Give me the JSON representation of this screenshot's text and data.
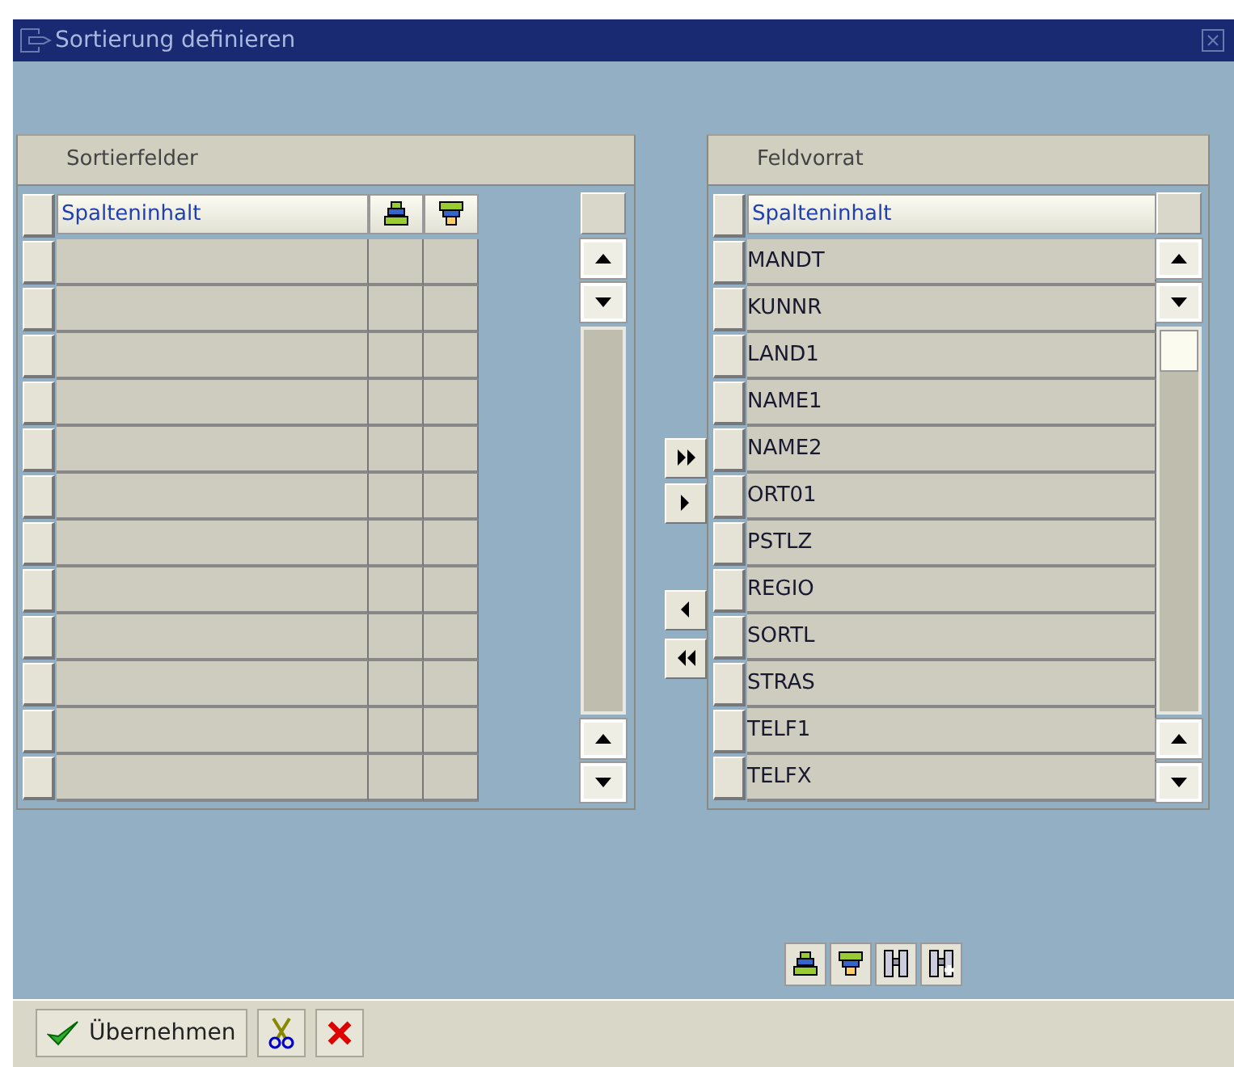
{
  "window": {
    "title": "Sortierung definieren"
  },
  "sort_fields": {
    "title": "Sortierfelder",
    "column": "Spalteninhalt"
  },
  "field_pool": {
    "title": "Feldvorrat",
    "column": "Spalteninhalt",
    "rows": [
      "MANDT",
      "KUNNR",
      "LAND1",
      "NAME1",
      "NAME2",
      "ORT01",
      "PSTLZ",
      "REGIO",
      "SORTL",
      "STRAS",
      "TELF1",
      "TELFX"
    ]
  },
  "toolbar": [
    {
      "kind": "accept",
      "label": "Übernehmen"
    },
    {
      "kind": "cut"
    },
    {
      "kind": "cancel"
    }
  ]
}
